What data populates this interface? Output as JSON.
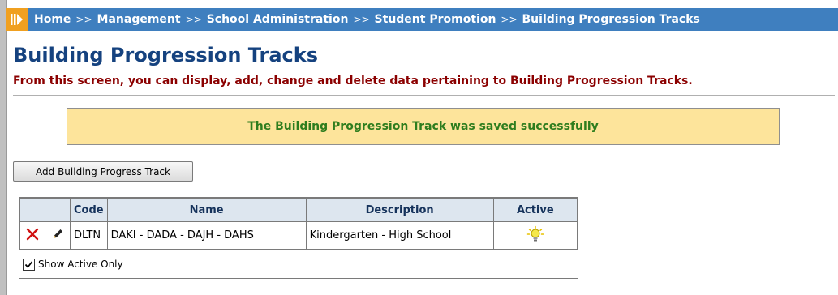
{
  "breadcrumb": {
    "items": [
      "Home",
      "Management",
      "School Administration",
      "Student Promotion",
      "Building Progression Tracks"
    ],
    "separator": ">>"
  },
  "page": {
    "title": "Building Progression Tracks",
    "subtitle": "From this screen, you can display, add, change and delete data pertaining to Building Progression Tracks."
  },
  "alert": {
    "message": "The Building Progression Track was saved successfully"
  },
  "toolbar": {
    "add_label": "Add Building Progress Track"
  },
  "grid": {
    "columns": [
      "",
      "",
      "Code",
      "Name",
      "Description",
      "Active"
    ],
    "rows": [
      {
        "code": "DLTN",
        "name": "DAKI - DADA - DAJH - DAHS",
        "description": "Kindergarten - High School",
        "active": true
      }
    ],
    "footer": {
      "show_active_only_label": "Show Active Only",
      "show_active_only_checked": true
    }
  },
  "colors": {
    "breadcrumb_bg": "#3f7fbf",
    "title": "#15427f",
    "subtitle": "#8b0000",
    "alert_bg": "#fde49b",
    "alert_text": "#2e7d1e",
    "delete_icon": "#d01010",
    "bulb_icon": "#f5e84a"
  },
  "icons": {
    "app_logo": "app-logo-icon",
    "delete": "delete-icon",
    "edit": "pencil-icon",
    "active": "lightbulb-icon",
    "checkbox": "checkmark-icon"
  }
}
